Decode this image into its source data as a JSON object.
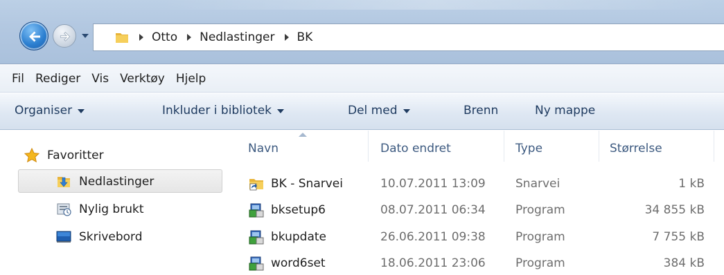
{
  "address_bar": {
    "breadcrumbs": [
      "Otto",
      "Nedlastinger",
      "BK"
    ],
    "icons": {
      "back": "back-arrow-icon",
      "forward": "forward-arrow-icon",
      "history": "chevron-down-icon",
      "folder": "folder-icon"
    }
  },
  "menu": {
    "items": [
      "Fil",
      "Rediger",
      "Vis",
      "Verktøy",
      "Hjelp"
    ]
  },
  "command_bar": {
    "organise": "Organiser",
    "include_library": "Inkluder i bibliotek",
    "share_with": "Del med",
    "burn": "Brenn",
    "new_folder": "Ny mappe"
  },
  "nav_pane": {
    "favorites_label": "Favoritter",
    "items": [
      {
        "label": "Nedlastinger",
        "icon": "downloads-folder-icon",
        "selected": true
      },
      {
        "label": "Nylig brukt",
        "icon": "recent-places-icon",
        "selected": false
      },
      {
        "label": "Skrivebord",
        "icon": "desktop-icon",
        "selected": false
      }
    ]
  },
  "file_list": {
    "columns": [
      "Navn",
      "Dato endret",
      "Type",
      "Størrelse"
    ],
    "rows": [
      {
        "name": "BK - Snarvei",
        "date": "10.07.2011 13:09",
        "type": "Snarvei",
        "size": "1 kB",
        "icon": "shortcut-icon"
      },
      {
        "name": "bksetup6",
        "date": "08.07.2011 06:34",
        "type": "Program",
        "size": "34 855 kB",
        "icon": "setup-program-icon"
      },
      {
        "name": "bkupdate",
        "date": "26.06.2011 09:38",
        "type": "Program",
        "size": "7 755 kB",
        "icon": "setup-program-icon"
      },
      {
        "name": "word6set",
        "date": "18.06.2011 23:06",
        "type": "Program",
        "size": "384 kB",
        "icon": "setup-program-icon"
      }
    ]
  }
}
